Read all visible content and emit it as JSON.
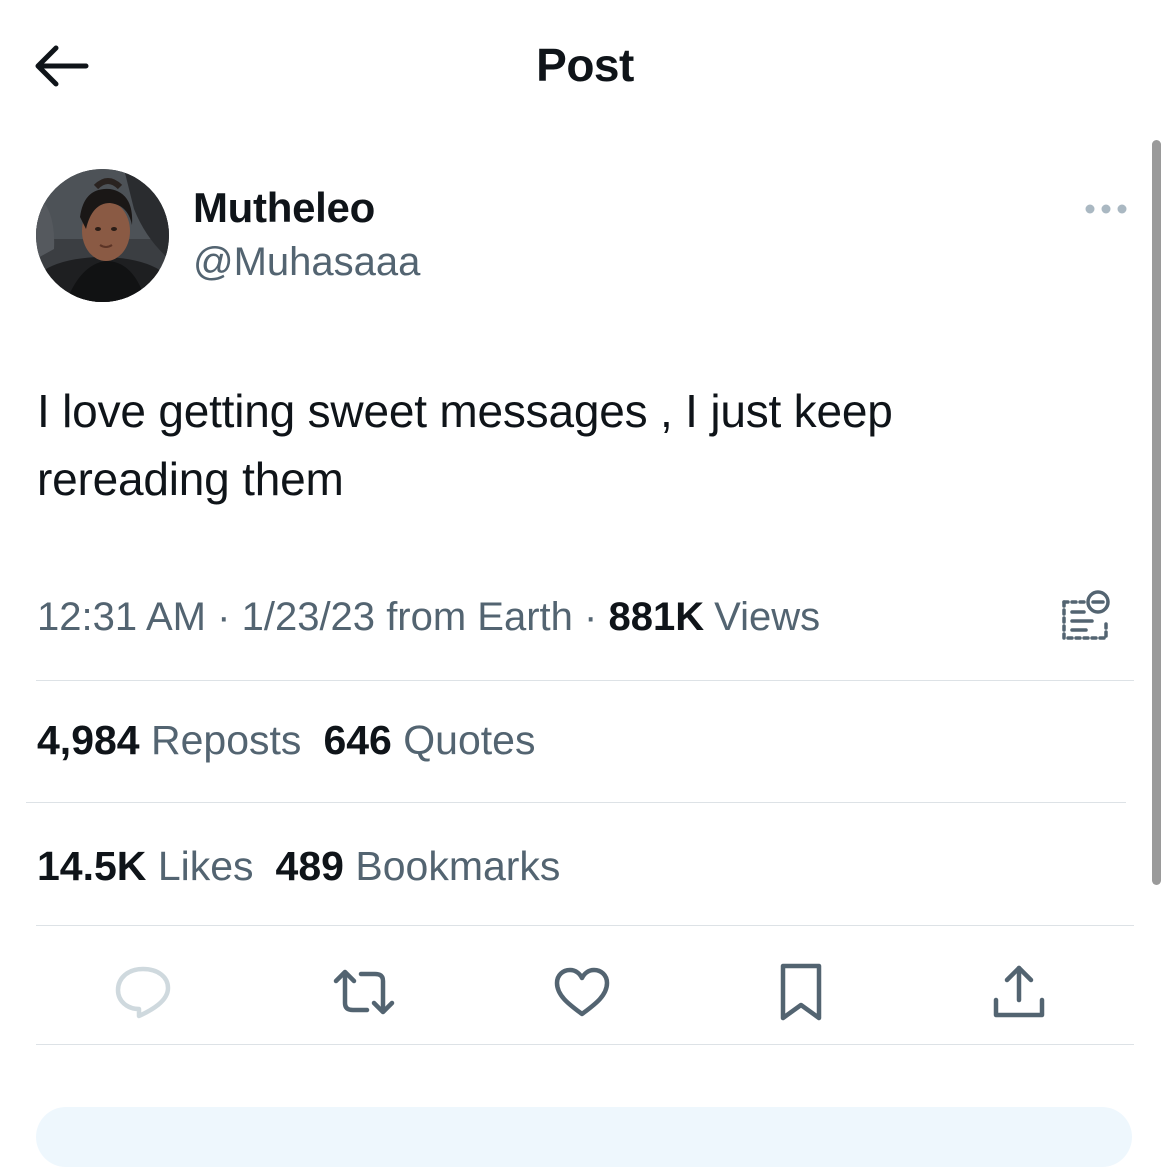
{
  "header": {
    "title": "Post",
    "back_icon": "arrow-left-icon"
  },
  "author": {
    "display_name": "Mutheleo",
    "handle": "@Muhasaaa",
    "avatar": "profile-photo"
  },
  "post": {
    "text_line1": "I love getting sweet messages , I just keep",
    "text_line2": "rereading them"
  },
  "meta": {
    "time": "12:31 AM",
    "separator": "·",
    "date": "1/23/23",
    "source": "from Earth",
    "views_count": "881K",
    "views_label": "Views"
  },
  "stats": {
    "reposts_count": "4,984",
    "reposts_label": "Reposts",
    "quotes_count": "646",
    "quotes_label": "Quotes",
    "likes_count": "14.5K",
    "likes_label": "Likes",
    "bookmarks_count": "489",
    "bookmarks_label": "Bookmarks"
  },
  "actions": [
    "reply-icon",
    "repost-icon",
    "like-icon",
    "bookmark-icon",
    "share-icon"
  ],
  "colors": {
    "text": "#0f1419",
    "secondary": "#536471",
    "divider": "#dde2e6",
    "action_icon": "#536471",
    "reply_icon_disabled": "#cfd9de"
  }
}
